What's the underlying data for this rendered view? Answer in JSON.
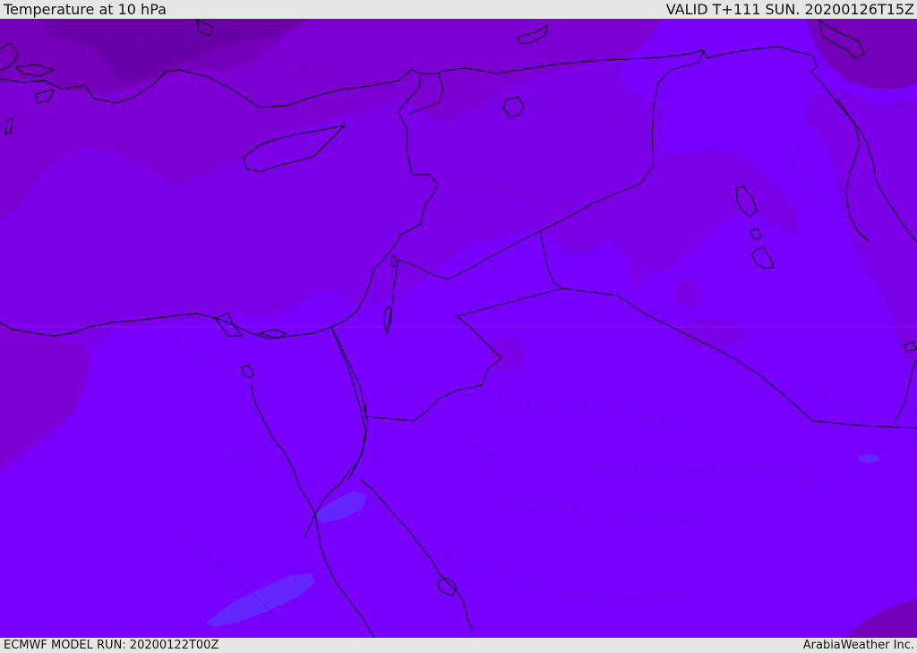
{
  "header": {
    "title": "Temperature at 10 hPa",
    "valid": "VALID T+111 SUN. 20200126T15Z"
  },
  "footer": {
    "model_run": "ECMWF MODEL RUN: 20200122T00Z",
    "credit": "ArabiaWeather Inc."
  },
  "colors": {
    "background": "#e6e6e6",
    "temp_level_1": "#6a00a8",
    "temp_level_2": "#7400bb",
    "temp_level_3": "#7d00d2",
    "temp_level_4": "#7b00e6",
    "temp_level_5": "#7900fc",
    "temp_level_6": "#6525ff",
    "coastline": "#000000"
  },
  "icons": [
    "coastline-layer",
    "border-layer",
    "temperature-field"
  ]
}
